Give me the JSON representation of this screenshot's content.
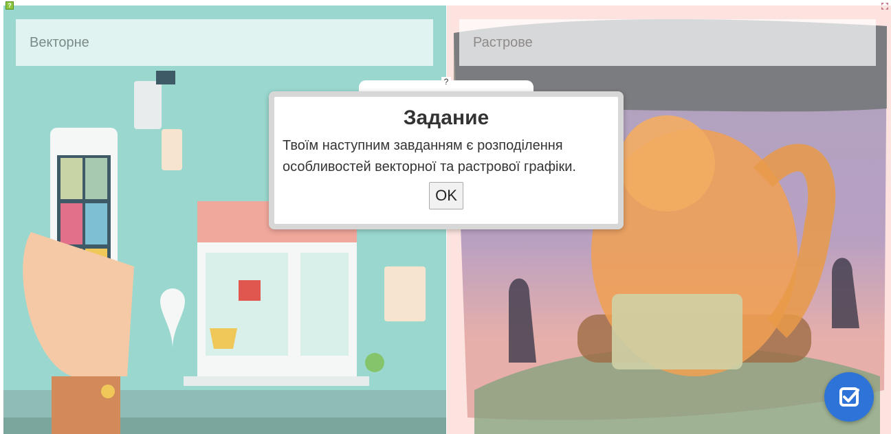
{
  "columns": {
    "left_title": "Векторне",
    "right_title": "Растрове"
  },
  "modal": {
    "title": "Задание",
    "message": "Твоїм наступним завданням є розподілення особливостей векторної та растрової графіки.",
    "ok_label": "OK"
  },
  "hint": {
    "symbol": "?"
  },
  "icons": {
    "help": "help-icon",
    "fullscreen": "fullscreen-icon",
    "check": "check-icon"
  },
  "colors": {
    "left_bg": "#9ad8cf",
    "right_bg": "#fde3df",
    "fab": "#2e74d8"
  }
}
